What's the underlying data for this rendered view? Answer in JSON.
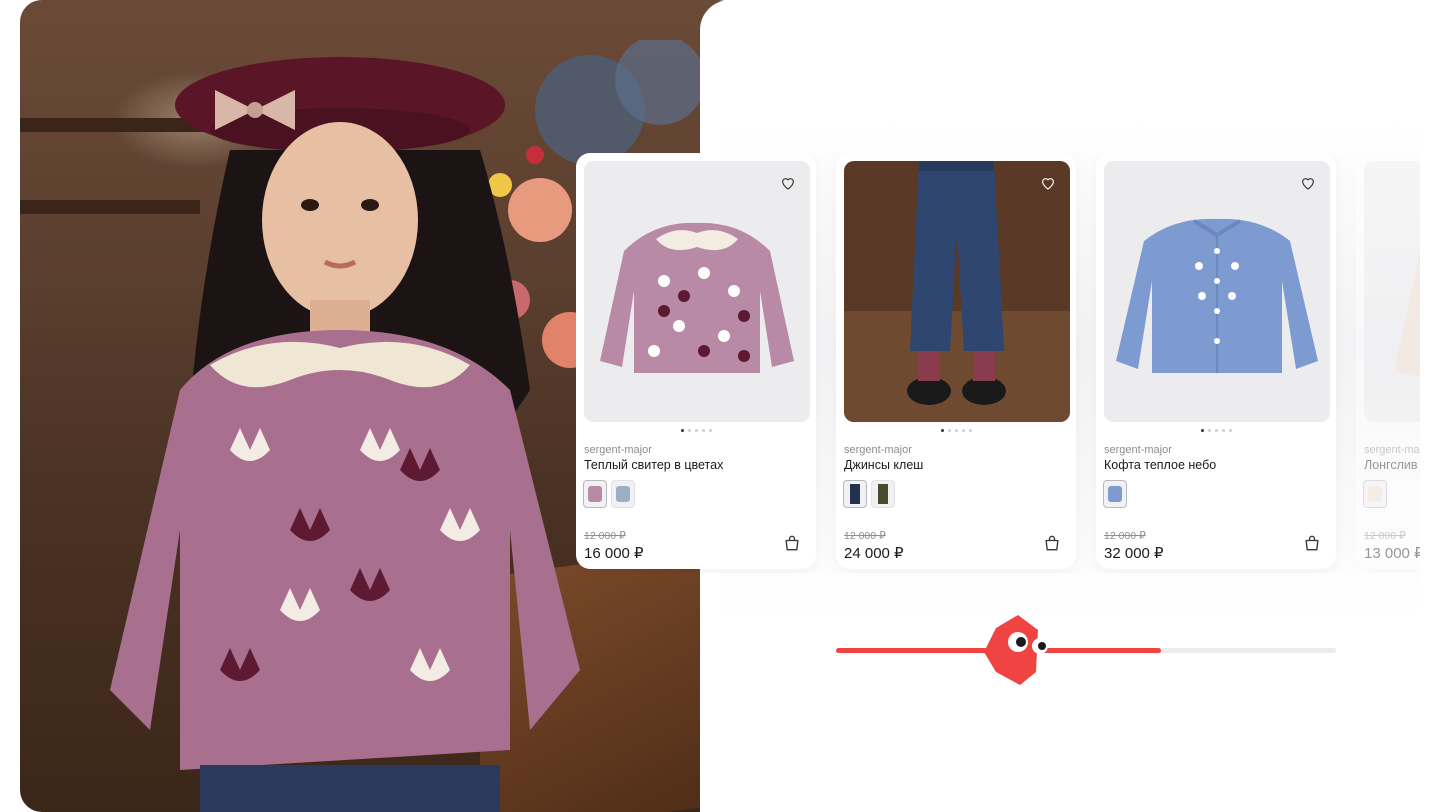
{
  "colors": {
    "accent": "#f04443",
    "panel": "#ffffff",
    "text_primary": "#1b1b1f",
    "text_muted": "#8c8c93"
  },
  "hero": {
    "icon": "hero-photo"
  },
  "products": [
    {
      "brand": "sergent-major",
      "title": "Теплый свитер в цветах",
      "old_price": "12 000 ₽",
      "price": "16 000 ₽",
      "colors": [
        "#b98aa6",
        "#9bb0c4"
      ],
      "dots_total": 5,
      "dot_active": 0
    },
    {
      "brand": "sergent-major",
      "title": "Джинсы клеш",
      "old_price": "12 000 ₽",
      "price": "24 000 ₽",
      "colors": [
        "#23314f",
        "#4a4a2e"
      ],
      "dots_total": 5,
      "dot_active": 0
    },
    {
      "brand": "sergent-major",
      "title": "Кофта теплое небо",
      "old_price": "12 000 ₽",
      "price": "32 000 ₽",
      "colors": [
        "#7e9bd1"
      ],
      "dots_total": 5,
      "dot_active": 0
    },
    {
      "brand": "sergent-ma",
      "title": "Лонгслив",
      "old_price": "12 000 ₽",
      "price": "13 000 ₽",
      "colors": [
        "#f0dccc"
      ],
      "dots_total": 5,
      "dot_active": 0
    }
  ],
  "slider": {
    "progress": 0.65,
    "thumb_position": 0.36,
    "thumb_icon": "mascot-icon"
  }
}
